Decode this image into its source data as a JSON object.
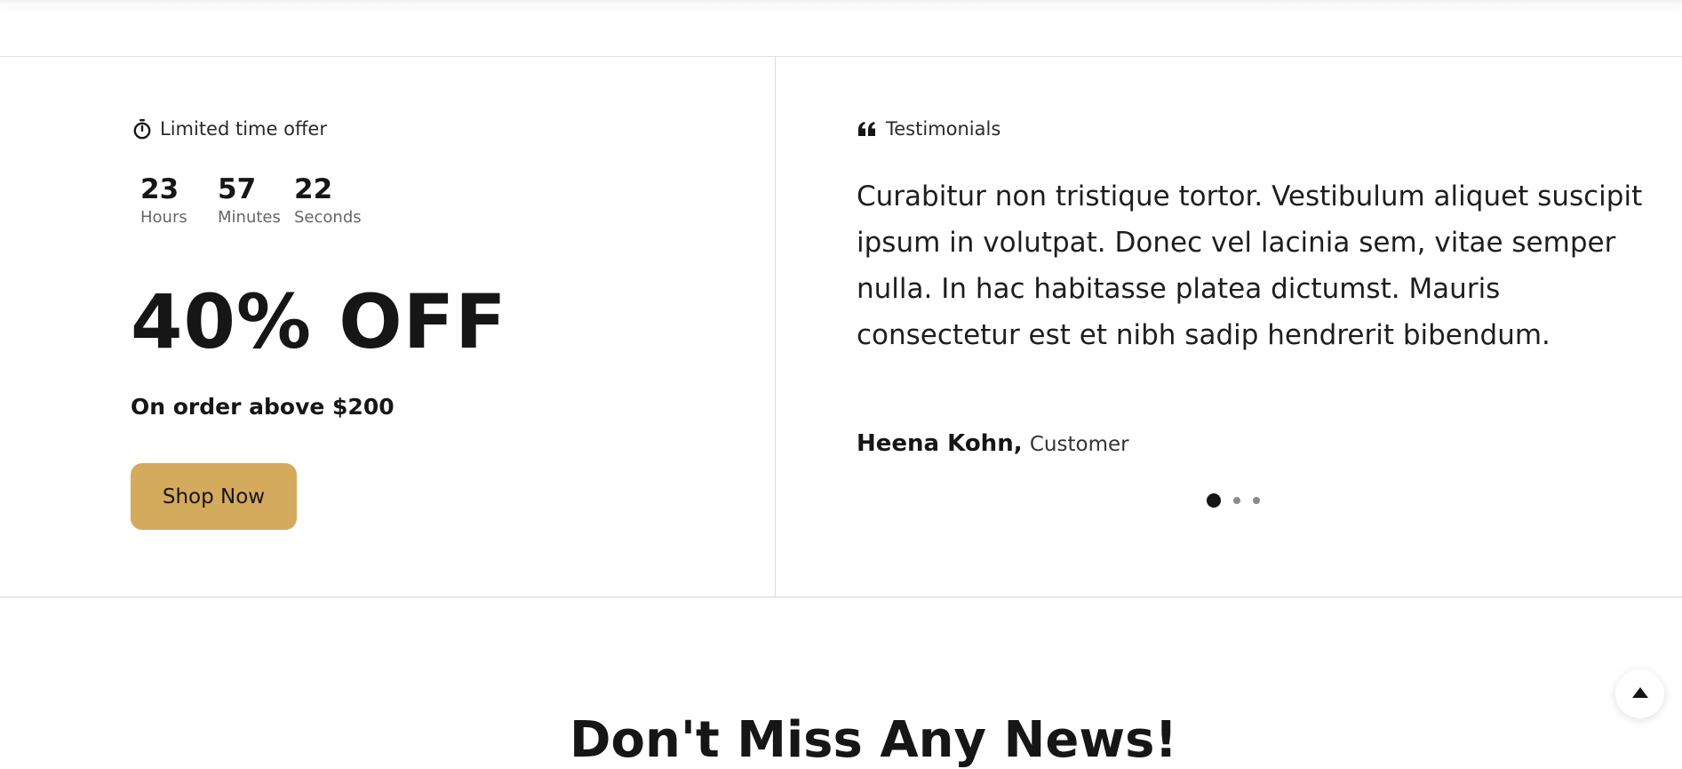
{
  "offer": {
    "eyebrow_icon": "stopwatch-icon",
    "eyebrow": "Limited time offer",
    "countdown": [
      {
        "value": "23",
        "label": "Hours"
      },
      {
        "value": "57",
        "label": "Minutes"
      },
      {
        "value": "22",
        "label": "Seconds"
      }
    ],
    "discount": "40% OFF",
    "condition": "On order above $200",
    "button_label": "Shop Now",
    "button_color": "#d4aa5d"
  },
  "testimonial": {
    "eyebrow_icon": "quote-icon",
    "eyebrow": "Testimonials",
    "quote": "Curabitur non tristique tortor. Vestibulum aliquet suscipit ipsum in volutpat. Donec vel lacinia sem, vitae semper nulla. In hac habitasse platea dictumst. Mauris consectetur est et nibh sadip hendrerit bibendum.",
    "author_name": "Heena Kohn,",
    "author_role": "Customer",
    "slide_count": 3,
    "active_slide": 1
  },
  "next_section": {
    "heading": "Don't Miss Any News!"
  },
  "back_to_top_icon": "arrow-up-icon"
}
